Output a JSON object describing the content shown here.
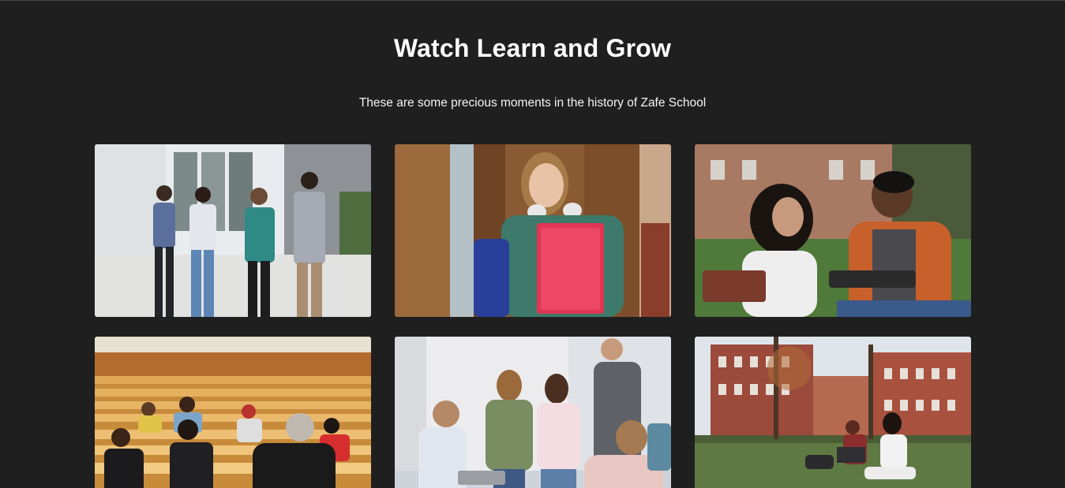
{
  "section": {
    "title": "Watch Learn and Grow",
    "subtitle": "These are some precious moments in the history of Zafe School"
  },
  "gallery": {
    "photos": [
      {
        "icon": "students-walking-photo"
      },
      {
        "icon": "student-holding-folder-photo"
      },
      {
        "icon": "students-studying-outdoors-photo"
      },
      {
        "icon": "lecture-hall-photo"
      },
      {
        "icon": "classroom-group-photo"
      },
      {
        "icon": "campus-lawn-photo"
      }
    ]
  }
}
